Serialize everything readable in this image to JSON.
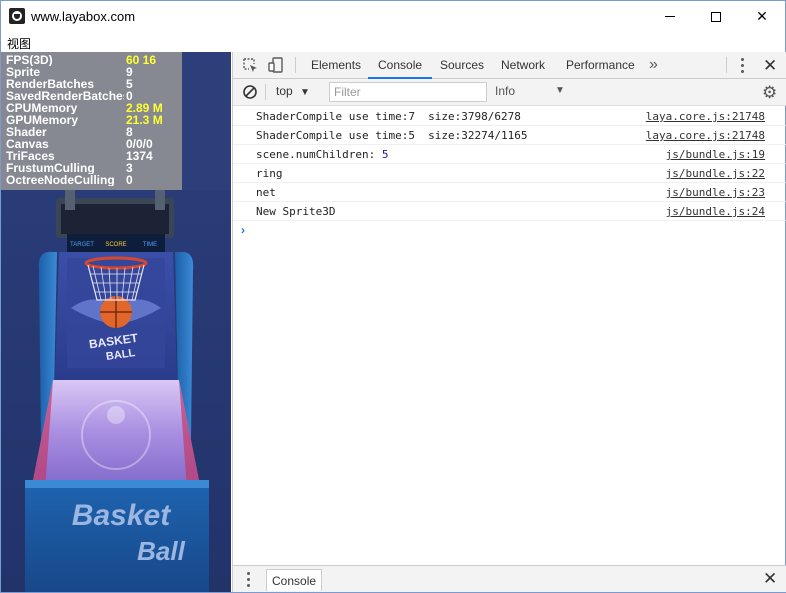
{
  "window": {
    "title": "www.layabox.com",
    "menu": "视图"
  },
  "stats": [
    {
      "label": "FPS(3D)",
      "value": "60 16",
      "highlight": true
    },
    {
      "label": "Sprite",
      "value": "9",
      "highlight": false
    },
    {
      "label": "RenderBatches",
      "value": "5",
      "highlight": false
    },
    {
      "label": "SavedRenderBatches",
      "value": "0",
      "highlight": false
    },
    {
      "label": "CPUMemory",
      "value": "2.89 M",
      "highlight": true
    },
    {
      "label": "GPUMemory",
      "value": "21.3 M",
      "highlight": true
    },
    {
      "label": "Shader",
      "value": "8",
      "highlight": false
    },
    {
      "label": "Canvas",
      "value": "0/0/0",
      "highlight": false
    },
    {
      "label": "TriFaces",
      "value": "1374",
      "highlight": false
    },
    {
      "label": "FrustumCulling",
      "value": "3",
      "highlight": false
    },
    {
      "label": "OctreeNodeCulling",
      "value": "0",
      "highlight": false
    }
  ],
  "game": {
    "scoreboard": [
      "TARGET",
      "SCORE",
      "TIME"
    ],
    "logo_text": "BASKET BALL",
    "front_text_1": "Basket",
    "front_text_2": "Ball"
  },
  "devtools": {
    "tabs": [
      "Elements",
      "Console",
      "Sources",
      "Network",
      "Performance"
    ],
    "active_tab": "Console",
    "more": "»",
    "context": "top",
    "filter_placeholder": "Filter",
    "level": "Info",
    "logs": [
      {
        "prefix": "ShaderCompile use time:7  size:3798/6278",
        "num": "",
        "source": "laya.core.js:21748"
      },
      {
        "prefix": "ShaderCompile use time:5  size:32274/1165",
        "num": "",
        "source": "laya.core.js:21748"
      },
      {
        "prefix": "scene.numChildren: ",
        "num": "5",
        "source": "js/bundle.js:19"
      },
      {
        "prefix": "ring",
        "num": "",
        "source": "js/bundle.js:22"
      },
      {
        "prefix": "net",
        "num": "",
        "source": "js/bundle.js:23"
      },
      {
        "prefix": "New Sprite3D",
        "num": "",
        "source": "js/bundle.js:24"
      }
    ],
    "prompt": "›",
    "drawer_tab": "Console"
  },
  "colors": {
    "stat_highlight": "#ffff33",
    "accent": "#1a73e8",
    "game_bg": "#2d3f7a"
  }
}
